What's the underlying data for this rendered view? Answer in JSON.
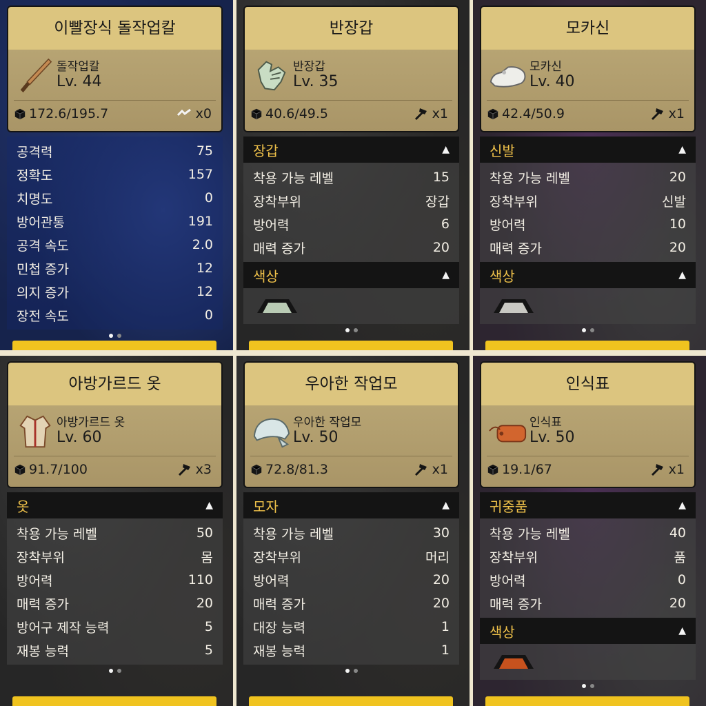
{
  "cards": [
    {
      "title": "이빨장식 돌작업칼",
      "name": "돌작업칼",
      "level": "Lv. 44",
      "weight": "172.6/195.7",
      "durability": "x0",
      "icon": "stone-knife-icon",
      "category": "",
      "stats": [
        {
          "label": "공격력",
          "value": "75"
        },
        {
          "label": "정확도",
          "value": "157"
        },
        {
          "label": "치명도",
          "value": "0"
        },
        {
          "label": "방어관통",
          "value": "191"
        },
        {
          "label": "공격 속도",
          "value": "2.0"
        },
        {
          "label": "민첩 증가",
          "value": "12"
        },
        {
          "label": "의지 증가",
          "value": "12"
        },
        {
          "label": "장전 속도",
          "value": "0"
        }
      ],
      "color_section": ""
    },
    {
      "title": "반장갑",
      "name": "반장갑",
      "level": "Lv. 35",
      "weight": "40.6/49.5",
      "durability": "x1",
      "icon": "glove-icon",
      "category": "장갑",
      "stats": [
        {
          "label": "착용 가능 레벨",
          "value": "15"
        },
        {
          "label": "장착부위",
          "value": "장갑"
        },
        {
          "label": "방어력",
          "value": "6"
        },
        {
          "label": "매력 증가",
          "value": "20"
        }
      ],
      "color_section": "색상",
      "swatch_color": "#b9cbb4"
    },
    {
      "title": "모카신",
      "name": "모카신",
      "level": "Lv. 40",
      "weight": "42.4/50.9",
      "durability": "x1",
      "icon": "moccasin-icon",
      "category": "신발",
      "stats": [
        {
          "label": "착용 가능 레벨",
          "value": "20"
        },
        {
          "label": "장착부위",
          "value": "신발"
        },
        {
          "label": "방어력",
          "value": "10"
        },
        {
          "label": "매력 증가",
          "value": "20"
        }
      ],
      "color_section": "색상",
      "swatch_color": "#c9c9c3"
    },
    {
      "title": "아방가르드 옷",
      "name": "아방가르드 옷",
      "level": "Lv. 60",
      "weight": "91.7/100",
      "durability": "x3",
      "icon": "clothes-icon",
      "category": "옷",
      "stats": [
        {
          "label": "착용 가능 레벨",
          "value": "50"
        },
        {
          "label": "장착부위",
          "value": "몸"
        },
        {
          "label": "방어력",
          "value": "110"
        },
        {
          "label": "매력 증가",
          "value": "20"
        },
        {
          "label": "방어구 제작 능력",
          "value": "5"
        },
        {
          "label": "재봉 능력",
          "value": "5"
        }
      ],
      "color_section": ""
    },
    {
      "title": "우아한 작업모",
      "name": "우아한 작업모",
      "level": "Lv. 50",
      "weight": "72.8/81.3",
      "durability": "x1",
      "icon": "work-cap-icon",
      "category": "모자",
      "stats": [
        {
          "label": "착용 가능 레벨",
          "value": "30"
        },
        {
          "label": "장착부위",
          "value": "머리"
        },
        {
          "label": "방어력",
          "value": "20"
        },
        {
          "label": "매력 증가",
          "value": "20"
        },
        {
          "label": "대장 능력",
          "value": "1"
        },
        {
          "label": "재봉 능력",
          "value": "1"
        }
      ],
      "color_section": ""
    },
    {
      "title": "인식표",
      "name": "인식표",
      "level": "Lv. 50",
      "weight": "19.1/67",
      "durability": "x1",
      "icon": "tag-icon",
      "category": "귀중품",
      "stats": [
        {
          "label": "착용 가능 레벨",
          "value": "40"
        },
        {
          "label": "장착부위",
          "value": "품"
        },
        {
          "label": "방어력",
          "value": "0"
        },
        {
          "label": "매력 증가",
          "value": "20"
        }
      ],
      "color_section": "색상",
      "swatch_color": "#c7521e"
    }
  ],
  "colors": {
    "title_bg": "#dcc57f",
    "info_bg": "#b0a070",
    "section_text": "#f0c24a",
    "action_bar": "#f0c31f"
  }
}
